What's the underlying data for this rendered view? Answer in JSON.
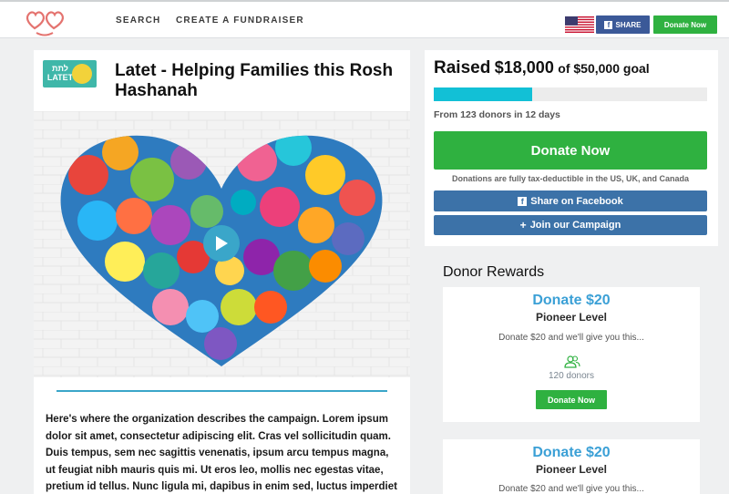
{
  "nav": {
    "search": "SEARCH",
    "create": "CREATE A FUNDRAISER",
    "share": "SHARE",
    "donate": "Donate Now"
  },
  "org_logo": {
    "text": "לתת LATET"
  },
  "campaign": {
    "title": "Latet - Helping Families this Rosh Hashanah",
    "description": "Here's where the organization describes the campaign. Lorem ipsum dolor sit amet, consectetur adipiscing elit. Cras vel sollicitudin quam. Duis tempus, sem nec sagittis venenatis, ipsum arcu tempus magna, ut feugiat nibh mauris quis mi. Ut eros leo, mollis nec egestas vitae, pretium id tellus. Nunc ligula mi, dapibus in enim sed, luctus imperdiet enim."
  },
  "funding": {
    "raised_label": "Raised",
    "raised_amount": "$18,000",
    "goal_text": "of $50,000 goal",
    "progress_fraction": 0.36,
    "donors_info": "From 123 donors in 12 days",
    "donate_button": "Donate Now",
    "tax_note": "Donations are fully tax-deductible in the US, UK, and Canada",
    "facebook_button": "Share on Facebook",
    "join_button": "Join our Campaign"
  },
  "rewards": {
    "title": "Donor Rewards",
    "items": [
      {
        "amount": "Donate $20",
        "level": "Pioneer Level",
        "description": "Donate $20 and we'll give you this...",
        "donors": "120 donors",
        "button": "Donate Now"
      },
      {
        "amount": "Donate $20",
        "level": "Pioneer Level",
        "description": "Donate $20 and we'll give you this..."
      }
    ]
  },
  "colors": {
    "donate_green": "#2fb140",
    "facebook_blue": "#3b5998",
    "accent_blue": "#3ba0d6",
    "progress_cyan": "#12c0d6"
  }
}
